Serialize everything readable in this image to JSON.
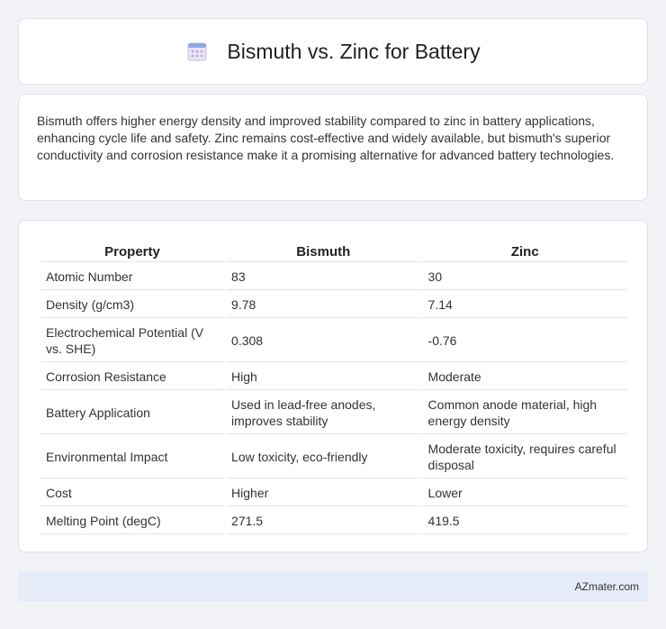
{
  "header": {
    "title": "Bismuth vs. Zinc for Battery",
    "icon": "calendar-icon"
  },
  "summary": "Bismuth offers higher energy density and improved stability compared to zinc in battery applications, enhancing cycle life and safety. Zinc remains cost-effective and widely available, but bismuth's superior conductivity and corrosion resistance make it a promising alternative for advanced battery technologies.",
  "table": {
    "headers": [
      "Property",
      "Bismuth",
      "Zinc"
    ],
    "rows": [
      [
        "Atomic Number",
        "83",
        "30"
      ],
      [
        "Density (g/cm3)",
        "9.78",
        "7.14"
      ],
      [
        "Electrochemical Potential (V vs. SHE)",
        "0.308",
        "-0.76"
      ],
      [
        "Corrosion Resistance",
        "High",
        "Moderate"
      ],
      [
        "Battery Application",
        "Used in lead-free anodes, improves stability",
        "Common anode material, high energy density"
      ],
      [
        "Environmental Impact",
        "Low toxicity, eco-friendly",
        "Moderate toxicity, requires careful disposal"
      ],
      [
        "Cost",
        "Higher",
        "Lower"
      ],
      [
        "Melting Point (degC)",
        "271.5",
        "419.5"
      ]
    ]
  },
  "footer": {
    "brand": "AZmater.com"
  }
}
